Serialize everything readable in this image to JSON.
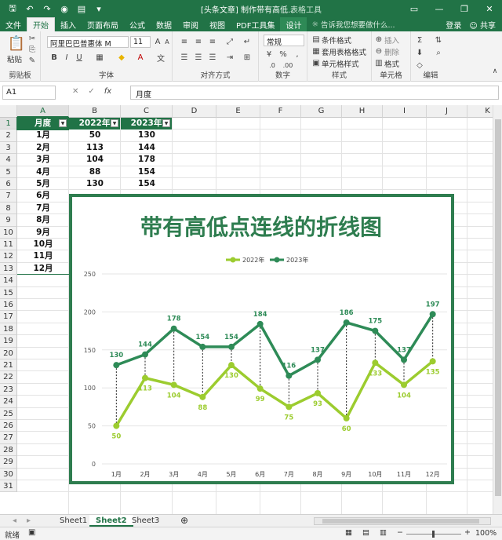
{
  "titlebar": {
    "title": "[头条文章] 制作带有高低...",
    "context": "表格工具"
  },
  "tabs": [
    {
      "label": "文件"
    },
    {
      "label": "开始"
    },
    {
      "label": "插入"
    },
    {
      "label": "页面布局"
    },
    {
      "label": "公式"
    },
    {
      "label": "数据"
    },
    {
      "label": "审阅"
    },
    {
      "label": "视图"
    },
    {
      "label": "PDF工具集"
    },
    {
      "label": "设计"
    }
  ],
  "tell_me": "告诉我您想要做什么...",
  "signin": "登录",
  "share": "共享",
  "ribbon": {
    "paste": "粘贴",
    "clipboard": "剪贴板",
    "font_name": "阿里巴巴普惠体 M",
    "font_size": "11",
    "font_group": "字体",
    "align_group": "对齐方式",
    "number_format": "常规",
    "number_group": "数字",
    "cond_format": "条件格式",
    "table_format": "套用表格格式",
    "cell_style": "单元格样式",
    "styles_group": "样式",
    "insert": "插入",
    "delete": "删除",
    "format": "格式",
    "cells_group": "单元格",
    "editing_group": "编辑"
  },
  "formula": {
    "namebox": "A1",
    "fx": "fx",
    "value": "月度"
  },
  "columns": [
    "A",
    "B",
    "C",
    "D",
    "E",
    "F",
    "G",
    "H",
    "I",
    "J",
    "K"
  ],
  "rows": [
    "1",
    "2",
    "3",
    "4",
    "5",
    "6",
    "7",
    "8",
    "9",
    "10",
    "11",
    "12",
    "13",
    "14",
    "15",
    "16",
    "17",
    "18",
    "19",
    "20",
    "21",
    "22",
    "23",
    "24",
    "25",
    "26",
    "27",
    "28",
    "29",
    "30",
    "31"
  ],
  "table": {
    "headers": [
      "月度",
      "2022年",
      "2023年"
    ],
    "months": [
      "1月",
      "2月",
      "3月",
      "4月",
      "5月",
      "6月",
      "7月",
      "8月",
      "9月",
      "10月",
      "11月",
      "12月"
    ],
    "col_2022": [
      "50",
      "113",
      "104",
      "88",
      "130"
    ],
    "col_2023": [
      "130",
      "144",
      "178",
      "154",
      "154"
    ]
  },
  "chart_data": {
    "type": "line",
    "title": "带有高低点连线的折线图",
    "categories": [
      "1月",
      "2月",
      "3月",
      "4月",
      "5月",
      "6月",
      "7月",
      "8月",
      "9月",
      "10月",
      "11月",
      "12月"
    ],
    "series": [
      {
        "name": "2022年",
        "values": [
          50,
          113,
          104,
          88,
          130,
          99,
          75,
          93,
          60,
          133,
          104,
          135
        ]
      },
      {
        "name": "2023年",
        "values": [
          130,
          144,
          178,
          154,
          154,
          184,
          116,
          137,
          186,
          175,
          137,
          197
        ]
      }
    ],
    "yticks": [
      "0",
      "50",
      "100",
      "150",
      "200",
      "250"
    ],
    "ylim": [
      0,
      250
    ],
    "legend": "top",
    "grid": true,
    "colors": {
      "s2022": "#9ccc2f",
      "s2023": "#2e8b57",
      "title": "#2e7d4f",
      "border": "#2e7d4f"
    }
  },
  "sheets": [
    "Sheet1",
    "Sheet2",
    "Sheet3"
  ],
  "active_sheet": "Sheet2",
  "status": {
    "ready": "就绪",
    "zoom": "100%"
  }
}
